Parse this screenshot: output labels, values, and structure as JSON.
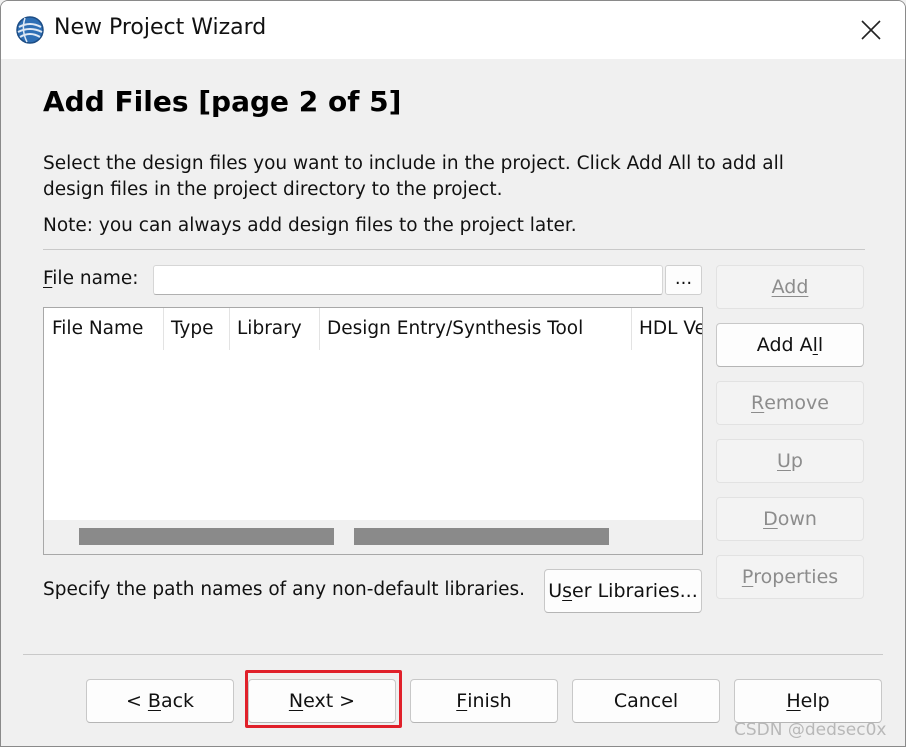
{
  "window": {
    "title": "New Project Wizard",
    "close_glyph": "✕"
  },
  "page": {
    "title": "Add Files [page 2 of 5]",
    "description": "Select the design files you want to include in the project. Click Add All to add all design files in the project directory to the project.",
    "note": "Note: you can always add design files to the project later."
  },
  "file_name": {
    "label_u": "F",
    "label_rest": "ile name:",
    "value": "",
    "browse_label": "..."
  },
  "table": {
    "columns": [
      "File Name",
      "Type",
      "Library",
      "Design Entry/Synthesis Tool",
      "HDL Ve"
    ],
    "rows": []
  },
  "side_buttons": {
    "add": "Add",
    "add_all_pre": "Add A",
    "add_all_u": "l",
    "add_all_post": "l",
    "remove_u": "R",
    "remove_rest": "emove",
    "up_u": "U",
    "up_rest": "p",
    "down_u": "D",
    "down_rest": "own",
    "properties_u": "P",
    "properties_rest": "roperties"
  },
  "libraries": {
    "text": "Specify the path names of any non-default libraries.",
    "button_pre": "U",
    "button_u": "s",
    "button_post": "er Libraries..."
  },
  "footer": {
    "back_pre": "< ",
    "back_u": "B",
    "back_post": "ack",
    "next_u": "N",
    "next_post": "ext >",
    "finish_u": "F",
    "finish_post": "inish",
    "cancel": "Cancel",
    "help_u": "H",
    "help_post": "elp"
  },
  "watermark": "CSDN @dedsec0x",
  "colors": {
    "highlight": "#e0202a",
    "disabled_text": "#8c8c8c",
    "scroll_thumb": "#8a8a8a"
  },
  "icons": {
    "app": "quartus-globe-icon",
    "close": "close-icon"
  }
}
